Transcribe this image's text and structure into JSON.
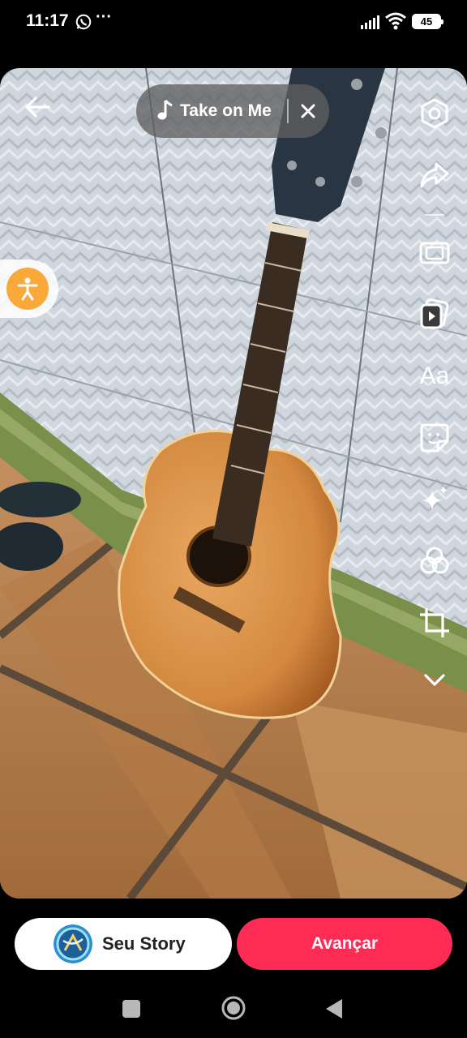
{
  "status_bar": {
    "time": "11:17",
    "overflow": "···",
    "battery": "45",
    "icons": [
      "whatsapp-icon",
      "signal-icon",
      "wifi-icon",
      "battery-icon"
    ]
  },
  "editor": {
    "music": {
      "title": "Take on Me"
    },
    "tools": [
      "settings-icon",
      "share-icon",
      "resize-icon",
      "clips-icon",
      "text-tool",
      "sticker-icon",
      "effects-icon",
      "filters-icon",
      "crop-icon",
      "more-chevron-icon"
    ],
    "text_tool_label": "Aa"
  },
  "bottom": {
    "story_label": "Seu Story",
    "next_label": "Avançar"
  },
  "colors": {
    "primary": "#fe2c55",
    "accessibility": "#f9a83a"
  }
}
